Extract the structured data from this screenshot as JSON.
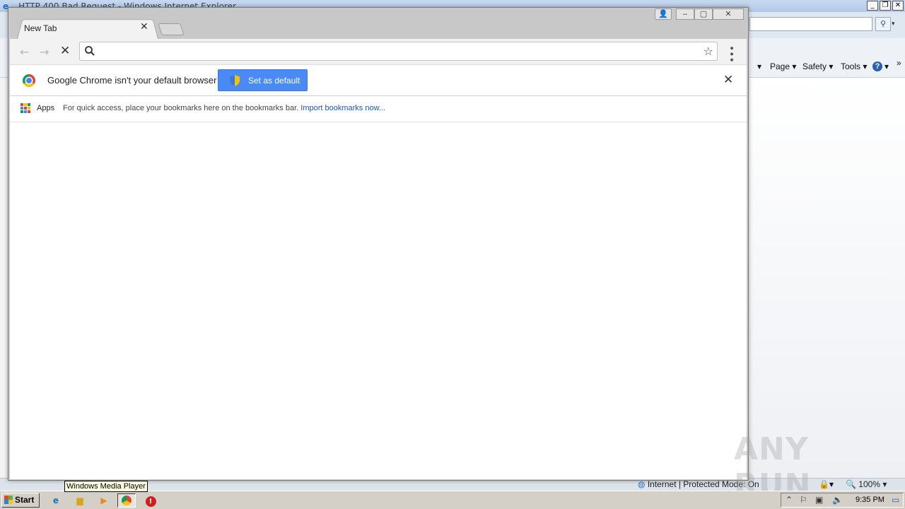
{
  "ie": {
    "title": "HTTP 400 Bad Request - Windows Internet Explorer",
    "commands": {
      "page": "Page",
      "safety": "Safety",
      "tools": "Tools"
    },
    "status_zone": "Internet | Protected Mode: On",
    "zoom": "100%"
  },
  "chrome": {
    "tab": {
      "label": "New Tab"
    },
    "omnibox": {
      "value": "",
      "placeholder": ""
    },
    "infobar": {
      "message": "Google Chrome isn't your default browser",
      "button_label": "Set as default"
    },
    "bookmarks": {
      "apps_label": "Apps",
      "hint": "For quick access, place your bookmarks here on the bookmarks bar.",
      "import_link": "Import bookmarks now..."
    }
  },
  "tooltip": {
    "text": "Windows Media Player"
  },
  "taskbar": {
    "start_label": "Start",
    "clock": "9:35 PM"
  },
  "watermark": {
    "text": "ANY RUN"
  },
  "colors": {
    "set_default_button": "#4a8af4",
    "link": "#1a57a8",
    "chrome_frame": "#c8c8c8"
  }
}
